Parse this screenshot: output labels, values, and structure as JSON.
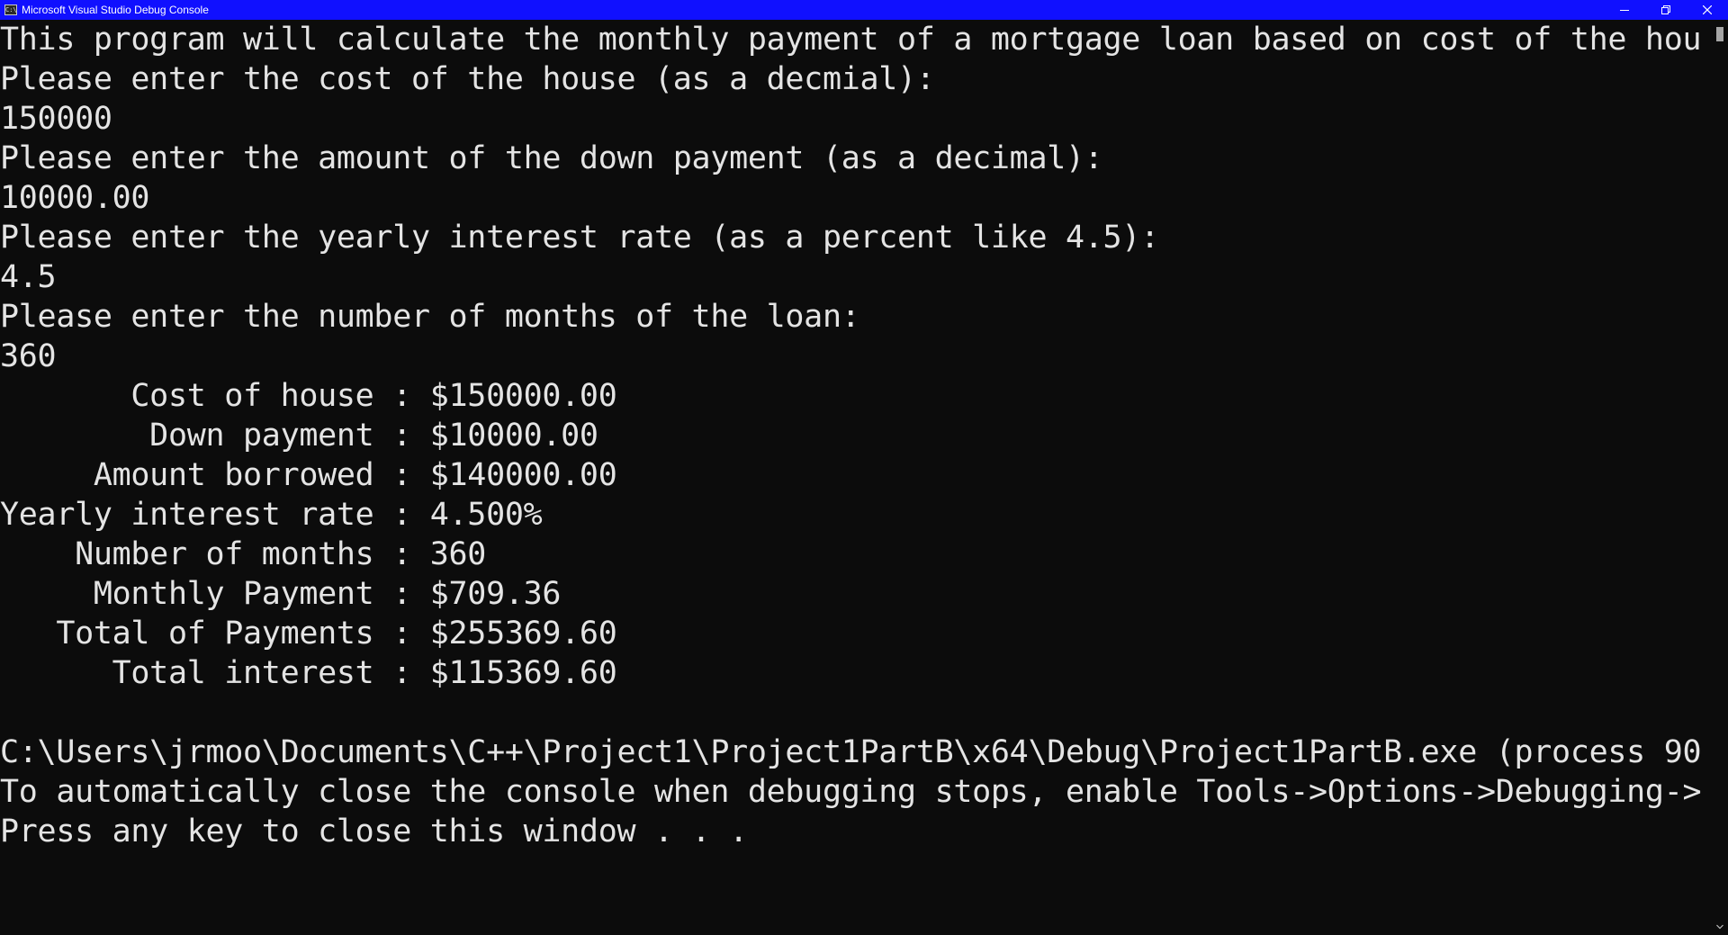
{
  "window": {
    "title": "Microsoft Visual Studio Debug Console",
    "icon_text": "C:\\",
    "controls": [
      "minimize-icon",
      "restore-icon",
      "close-icon"
    ]
  },
  "console": {
    "lines": [
      "This program will calculate the monthly payment of a mortgage loan based on cost of the hou",
      "Please enter the cost of the house (as a decmial):",
      "150000",
      "Please enter the amount of the down payment (as a decimal):",
      "10000.00",
      "Please enter the yearly interest rate (as a percent like 4.5):",
      "4.5",
      "Please enter the number of months of the loan:",
      "360",
      "       Cost of house : $150000.00",
      "        Down payment : $10000.00",
      "     Amount borrowed : $140000.00",
      "Yearly interest rate : 4.500%",
      "    Number of months : 360",
      "     Monthly Payment : $709.36",
      "   Total of Payments : $255369.60",
      "      Total interest : $115369.60",
      "",
      "C:\\Users\\jrmoo\\Documents\\C++\\Project1\\Project1PartB\\x64\\Debug\\Project1PartB.exe (process 90",
      "To automatically close the console when debugging stops, enable Tools->Options->Debugging->",
      "Press any key to close this window . . ."
    ]
  },
  "colors": {
    "titlebar": "#1010ff",
    "background": "#0c0c0c",
    "text": "#e4e4e4"
  }
}
